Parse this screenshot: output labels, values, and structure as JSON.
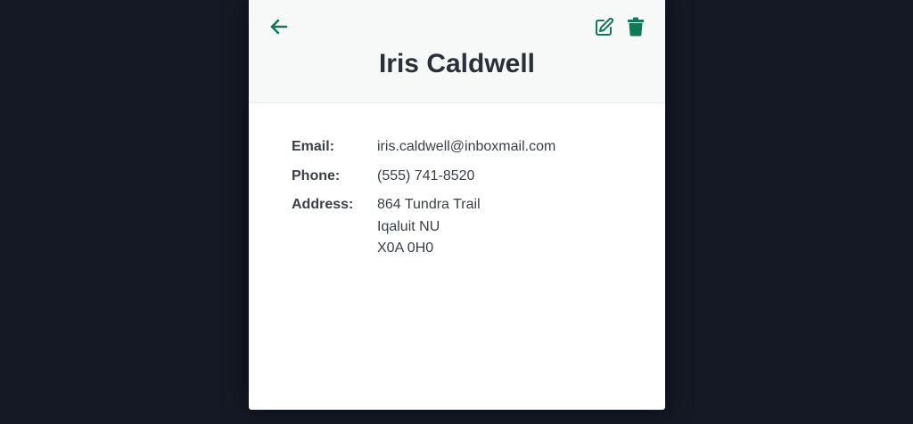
{
  "contact": {
    "name": "Iris Caldwell",
    "fields": {
      "email_label": "Email:",
      "email_value": "iris.caldwell@inboxmail.com",
      "phone_label": "Phone:",
      "phone_value": "(555) 741-8520",
      "address_label": "Address:",
      "address_lines": [
        "864 Tundra Trail",
        "Iqaluit NU",
        "X0A 0H0"
      ]
    }
  },
  "icons": {
    "back": "arrow-left-icon",
    "edit": "edit-icon",
    "delete": "trash-icon"
  },
  "colors": {
    "background": "#141925",
    "accent": "#0f7a55",
    "header_bg": "#f7f9f8",
    "card_bg": "#ffffff"
  }
}
